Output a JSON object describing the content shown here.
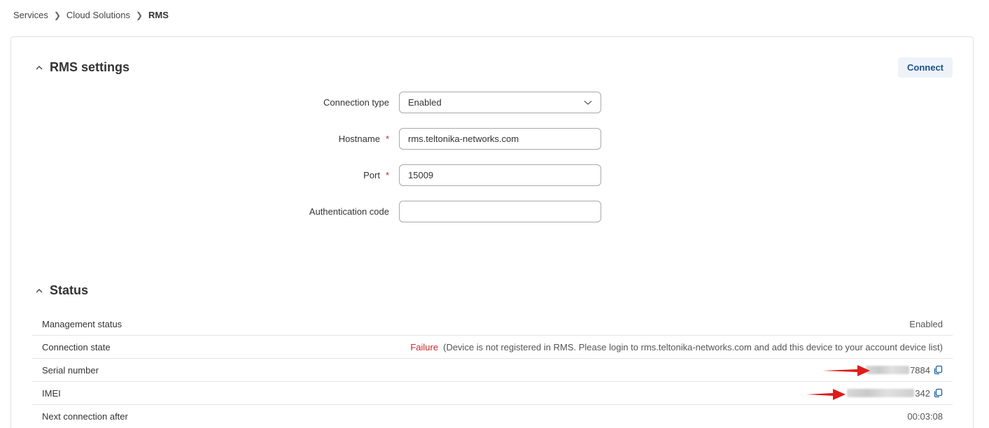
{
  "breadcrumb": {
    "items": [
      "Services",
      "Cloud Solutions"
    ],
    "current": "RMS"
  },
  "settings": {
    "title": "RMS settings",
    "connect_label": "Connect",
    "fields": {
      "connection_type": {
        "label": "Connection type",
        "value": "Enabled"
      },
      "hostname": {
        "label": "Hostname",
        "value": "rms.teltonika-networks.com",
        "required": "*"
      },
      "port": {
        "label": "Port",
        "value": "15009",
        "required": "*"
      },
      "auth_code": {
        "label": "Authentication code",
        "value": ""
      }
    }
  },
  "status": {
    "title": "Status",
    "rows": {
      "management": {
        "label": "Management status",
        "value": "Enabled"
      },
      "connection": {
        "label": "Connection state",
        "state": "Failure",
        "detail": "(Device is not registered in RMS. Please login to rms.teltonika-networks.com and add this device to your account device list)"
      },
      "serial": {
        "label": "Serial number",
        "value_tail": "7884"
      },
      "imei": {
        "label": "IMEI",
        "value_tail": "342"
      },
      "next": {
        "label": "Next connection after",
        "value": "00:03:08"
      }
    }
  },
  "colors": {
    "accent": "#1c4f8a",
    "error": "#c62828",
    "annotation": "#e01b1b"
  },
  "icons": [
    "chevron-right-icon",
    "chevron-up-icon",
    "chevron-down-icon",
    "copy-icon",
    "red-arrow-icon"
  ]
}
